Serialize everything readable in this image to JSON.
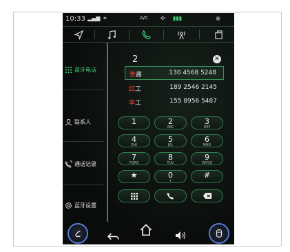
{
  "status": {
    "time": "10:33",
    "ac_label": "A/C"
  },
  "sidebar": {
    "items": [
      {
        "label": "蓝牙电话",
        "icon": "dialpad-icon"
      },
      {
        "label": "联系人",
        "icon": "person-icon"
      },
      {
        "label": "通话记录",
        "icon": "call-history-icon"
      },
      {
        "label": "蓝牙设置",
        "icon": "settings-icon"
      }
    ]
  },
  "dialer": {
    "input": "2",
    "suggestions": [
      {
        "prefix": "贵",
        "rest": "酱",
        "phone": "130 4568 5248"
      },
      {
        "prefix": "红",
        "rest": "工",
        "phone": "189 2546 2145"
      },
      {
        "prefix": "李",
        "rest": "工",
        "phone": "155 8956 5487"
      }
    ],
    "keys": [
      {
        "digit": "1",
        "letters": ""
      },
      {
        "digit": "2",
        "letters": "ABC"
      },
      {
        "digit": "3",
        "letters": "DEF"
      },
      {
        "digit": "4",
        "letters": "GHI"
      },
      {
        "digit": "5",
        "letters": "JKL"
      },
      {
        "digit": "6",
        "letters": "MNO"
      },
      {
        "digit": "7",
        "letters": "PQRS"
      },
      {
        "digit": "8",
        "letters": "TUV"
      },
      {
        "digit": "9",
        "letters": "WXYZ"
      },
      {
        "digit": "★",
        "letters": ""
      },
      {
        "digit": "0",
        "letters": "+"
      },
      {
        "digit": "#",
        "letters": ""
      }
    ]
  },
  "colors": {
    "accent": "#3fcf78",
    "highlight": "#ff3b3b",
    "border": "#2f7a4b",
    "background": "#0a0c0b"
  }
}
